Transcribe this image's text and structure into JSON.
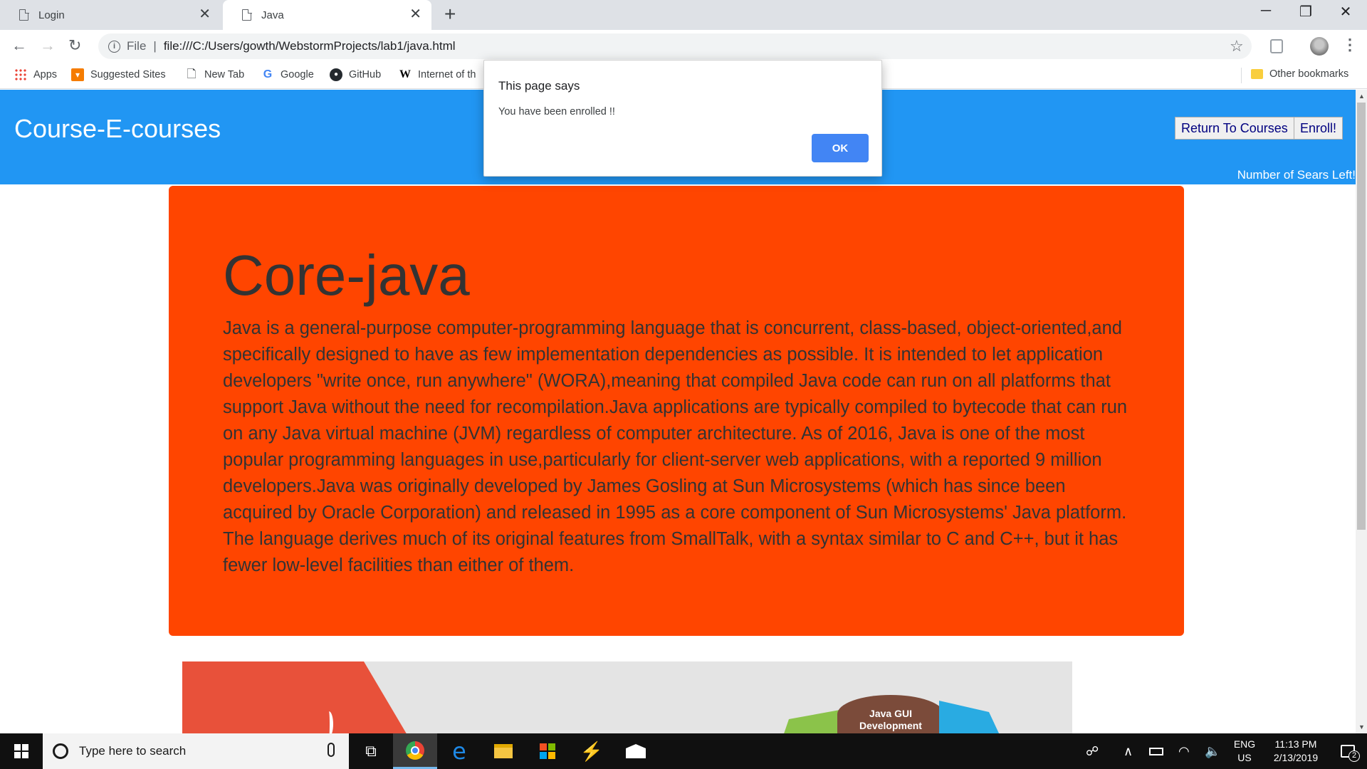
{
  "browser": {
    "tabs": [
      {
        "title": "Login",
        "active": false
      },
      {
        "title": "Java",
        "active": true
      }
    ],
    "new_tab": "+",
    "window_controls": {
      "minimize": "─",
      "maximize": "❐",
      "close": "✕"
    },
    "address": {
      "scheme_label": "File",
      "url": "file:///C:/Users/gowth/WebstormProjects/lab1/java.html"
    },
    "bookmarks": [
      {
        "label": "Apps",
        "icon": "apps-grid-icon"
      },
      {
        "label": "Suggested Sites",
        "icon": "suggested-sites-icon"
      },
      {
        "label": "New Tab",
        "icon": "page-icon"
      },
      {
        "label": "Google",
        "icon": "google-icon"
      },
      {
        "label": "GitHub",
        "icon": "github-icon"
      },
      {
        "label": "Internet of th",
        "icon": "wikipedia-icon"
      }
    ],
    "other_bookmarks": "Other bookmarks"
  },
  "page": {
    "site_title": "Course-E-courses",
    "buttons": {
      "return": "Return To Courses",
      "enroll": "Enroll!"
    },
    "seats_label": "Number of Sears Left!",
    "course": {
      "title": "Core-java",
      "description": "Java is a general-purpose computer-programming language that is concurrent, class-based, object-oriented,and specifically designed to have as few implementation dependencies as possible. It is intended to let application developers \"write once, run anywhere\" (WORA),meaning that compiled Java code can run on all platforms that support Java without the need for recompilation.Java applications are typically compiled to bytecode that can run on any Java virtual machine (JVM) regardless of computer architecture. As of 2016, Java is one of the most popular programming languages in use,particularly for client-server web applications, with a reported 9 million developers.Java was originally developed by James Gosling at Sun Microsystems (which has since been acquired by Oracle Corporation) and released in 1995 as a core component of Sun Microsystems' Java platform. The language derives much of its original features from SmallTalk, with a syntax similar to C and C++, but it has fewer low-level facilities than either of them."
    },
    "image_label": "Java GUI Development",
    "colors": {
      "header": "#2196f3",
      "card": "#ff4500"
    }
  },
  "alert": {
    "title": "This page says",
    "message": "You have been enrolled !!",
    "ok": "OK"
  },
  "taskbar": {
    "search_placeholder": "Type here to search",
    "lang_line1": "ENG",
    "lang_line2": "US",
    "time": "11:13 PM",
    "date": "2/13/2019",
    "notifications": "2"
  }
}
